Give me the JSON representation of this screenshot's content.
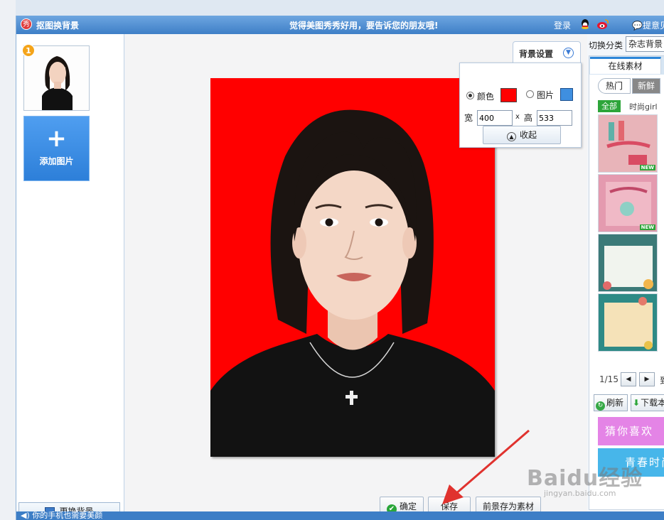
{
  "titlebar": {
    "logo_char": "秀",
    "title": "抠图换背景",
    "slogan": "觉得美图秀秀好用，要告诉您的朋友哦!",
    "login": "登录",
    "feedback": "提意见"
  },
  "left": {
    "thumb_badge": "1",
    "add_label": "添加图片",
    "change_bg_label": "更换背景"
  },
  "bg_settings": {
    "tab_label": "背景设置",
    "color_label": "颜色",
    "picture_label": "图片",
    "color_value": "#ff0000",
    "width_label": "宽",
    "width_value": "400",
    "x_label": "x",
    "height_label": "高",
    "height_value": "533",
    "collapse_label": "收起"
  },
  "actions": {
    "confirm_label": "确定",
    "save_label": "保存",
    "save_fg_label": "前景存为素材"
  },
  "right": {
    "category_label": "切换分类",
    "category_value": "杂志背景",
    "online_tab": "在线素材",
    "hot_label": "热门",
    "fresh_label": "新鲜",
    "all_chip": "全部",
    "trend_chip": "时尚girl",
    "new_badge": "NEW",
    "pager_text": "1/15",
    "pager_to": "到",
    "refresh_label": "刷新",
    "download_label": "下载本",
    "banner1": "猜你喜欢",
    "banner2": "青春时尚"
  },
  "status": {
    "text": "你的手机也需要美颜"
  },
  "watermark": {
    "main": "Baidu经验",
    "sub": "jingyan.baidu.com"
  }
}
